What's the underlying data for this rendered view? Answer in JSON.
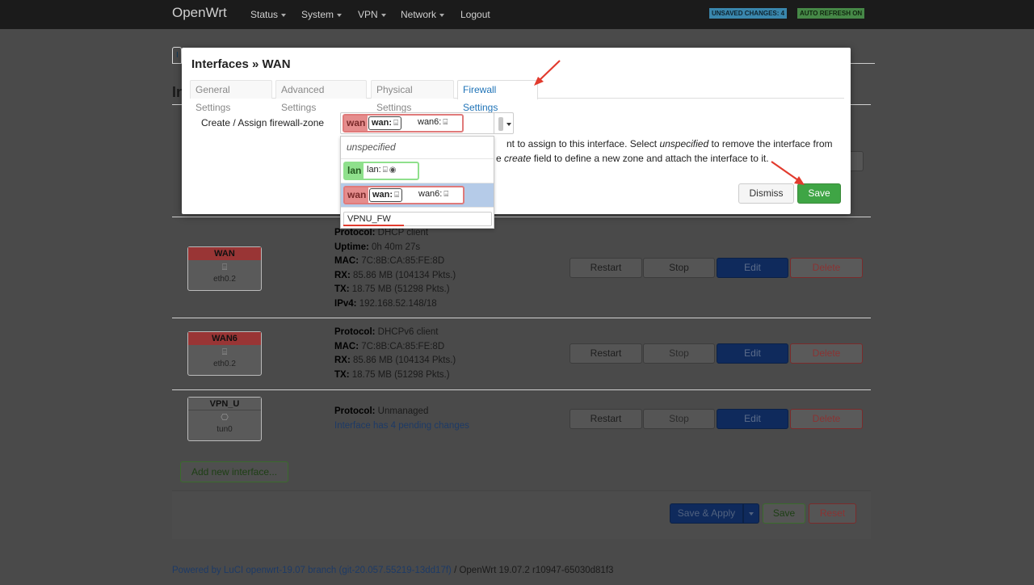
{
  "navbar": {
    "brand": "OpenWrt",
    "items": [
      "Status",
      "System",
      "VPN",
      "Network",
      "Logout"
    ],
    "badge_unsaved": "UNSAVED CHANGES: 4",
    "badge_refresh": "AUTO REFRESH ON"
  },
  "page": {
    "tab_fragment": "I",
    "heading_fragment": "In",
    "interfaces": [
      {
        "name": "WAN",
        "device": "eth0.2",
        "lines": [
          {
            "k": "Protocol:",
            "v": " DHCP client"
          },
          {
            "k": "Uptime:",
            "v": " 0h 40m 27s"
          },
          {
            "k": "MAC:",
            "v": " 7C:8B:CA:85:FE:8D"
          },
          {
            "k": "RX:",
            "v": " 85.86 MB (104134 Pkts.)"
          },
          {
            "k": "TX:",
            "v": " 18.75 MB (51298 Pkts.)"
          },
          {
            "k": "IPv4:",
            "v": " 192.168.52.148/18"
          }
        ]
      },
      {
        "name": "WAN6",
        "device": "eth0.2",
        "lines": [
          {
            "k": "Protocol:",
            "v": " DHCPv6 client"
          },
          {
            "k": "MAC:",
            "v": " 7C:8B:CA:85:FE:8D"
          },
          {
            "k": "RX:",
            "v": " 85.86 MB (104134 Pkts.)"
          },
          {
            "k": "TX:",
            "v": " 18.75 MB (51298 Pkts.)"
          }
        ]
      },
      {
        "name": "VPN_U",
        "device": "tun0",
        "lines": [
          {
            "k": "Protocol:",
            "v": " Unmanaged"
          }
        ],
        "pending": "Interface has 4 pending changes"
      }
    ],
    "row_buttons": {
      "restart": "Restart",
      "stop": "Stop",
      "edit": "Edit",
      "delete": "Delete"
    },
    "add_interface": "Add new interface...",
    "save_apply": "Save & Apply",
    "save": "Save",
    "reset": "Reset",
    "footer_link": "Powered by LuCI openwrt-19.07 branch (git-20.057.55219-13dd17f)",
    "footer_rest": " / OpenWrt 19.07.2 r10947-65030d81f3"
  },
  "modal": {
    "title": "Interfaces » WAN",
    "tabs": [
      "General Settings",
      "Advanced Settings",
      "Physical Settings",
      "Firewall Settings"
    ],
    "active_tab": "Firewall Settings",
    "field_label": "Create / Assign firewall-zone",
    "help_line1_a": "nt to assign to this interface. Select ",
    "help_line1_b": "unspecified",
    "help_line1_c": " to remove the interface from",
    "help_line2_a": "e ",
    "help_line2_b": "create",
    "help_line2_c": " field to define a new zone and attach the interface to it.",
    "selected_zone": {
      "zone": "wan",
      "nets": [
        "wan:",
        "wan6:"
      ]
    },
    "dropdown": {
      "unspecified": "unspecified",
      "lan": {
        "zone": "lan",
        "net": "lan:"
      },
      "wan": {
        "zone": "wan",
        "nets": [
          "wan:",
          "wan6:"
        ]
      },
      "create_value": "VPNU_FW"
    },
    "dismiss": "Dismiss",
    "save": "Save"
  },
  "colors": {
    "zone_red": "#e58d8d",
    "zone_green": "#8fe08c",
    "save_green": "#3fa545",
    "active_tab": "#1f73b7",
    "annotation_red": "#e23b2e"
  }
}
